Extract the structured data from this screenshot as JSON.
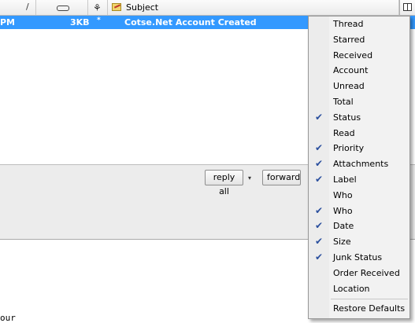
{
  "header": {
    "columns": [
      {
        "id": "date",
        "glyph": "/"
      },
      {
        "id": "size",
        "icon": "attachment-icon"
      },
      {
        "id": "junk",
        "icon": "junk-status-icon",
        "glyph": "⚘"
      },
      {
        "id": "subject",
        "label": "Subject",
        "icon": "subject-icon"
      },
      {
        "id": "picker",
        "icon": "column-picker-icon"
      }
    ]
  },
  "message": {
    "date": "PM",
    "size": "3KB",
    "flag": "*",
    "subject": "Cotse.Net Account Created"
  },
  "preview": {
    "reply_all_label": "reply all",
    "dropdown_glyph": "▾",
    "forward_label": "forward",
    "body_fragment": "our"
  },
  "menu": {
    "items": [
      {
        "label": "Thread",
        "checked": false
      },
      {
        "label": "Starred",
        "checked": false
      },
      {
        "label": "Received",
        "checked": false
      },
      {
        "label": "Account",
        "checked": false
      },
      {
        "label": "Unread",
        "checked": false
      },
      {
        "label": "Total",
        "checked": false
      },
      {
        "label": "Status",
        "checked": true
      },
      {
        "label": "Read",
        "checked": false
      },
      {
        "label": "Priority",
        "checked": true
      },
      {
        "label": "Attachments",
        "checked": true
      },
      {
        "label": "Label",
        "checked": true
      },
      {
        "label": "Who",
        "checked": false
      },
      {
        "label": "Who",
        "checked": true
      },
      {
        "label": "Date",
        "checked": true
      },
      {
        "label": "Size",
        "checked": true
      },
      {
        "label": "Junk Status",
        "checked": true
      },
      {
        "label": "Order Received",
        "checked": false
      },
      {
        "label": "Location",
        "checked": false
      }
    ],
    "check_glyph": "✔",
    "restore_label": "Restore Defaults"
  },
  "colors": {
    "selection": "#3399ff",
    "menu_bg": "#f2f2f2",
    "check": "#2a4f9e"
  }
}
